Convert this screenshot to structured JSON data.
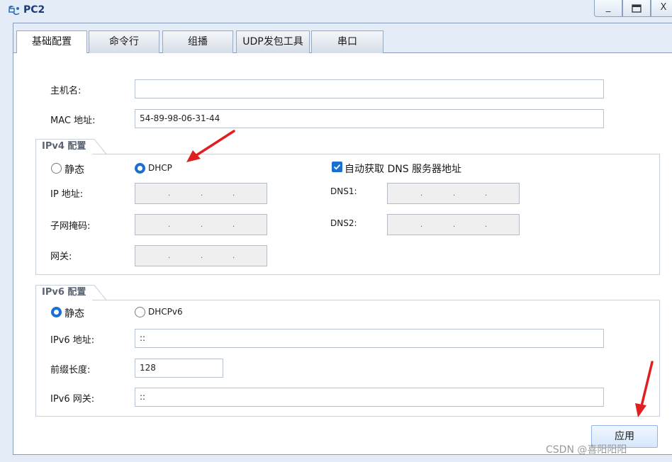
{
  "window": {
    "title": "PC2",
    "minimize": "_",
    "maximize": "□",
    "close": "X"
  },
  "tabs": [
    "基础配置",
    "命令行",
    "组播",
    "UDP发包工具",
    "串口"
  ],
  "basic": {
    "hostname_label": "主机名:",
    "hostname_value": "",
    "mac_label": "MAC 地址:",
    "mac_value": "54-89-98-06-31-44"
  },
  "ipv4": {
    "section_title": "IPv4 配置",
    "static_label": "静态",
    "dhcp_label": "DHCP",
    "mode": "DHCP",
    "auto_dns_label": "自动获取 DNS 服务器地址",
    "auto_dns_checked": true,
    "ip_label": "IP 地址:",
    "mask_label": "子网掩码:",
    "gateway_label": "网关:",
    "dns1_label": "DNS1:",
    "dns2_label": "DNS2:",
    "ip_separator": "."
  },
  "ipv6": {
    "section_title": "IPv6 配置",
    "static_label": "静态",
    "dhcpv6_label": "DHCPv6",
    "mode": "静态",
    "address_label": "IPv6 地址:",
    "address_value": "::",
    "prefix_label": "前缀长度:",
    "prefix_value": "128",
    "gateway_label": "IPv6 网关:",
    "gateway_value": "::"
  },
  "apply_label": "应用",
  "watermark": "CSDN @喜阳阳阳",
  "colors": {
    "accent": "#1a6fd4",
    "annotation_arrow": "#e02020"
  }
}
